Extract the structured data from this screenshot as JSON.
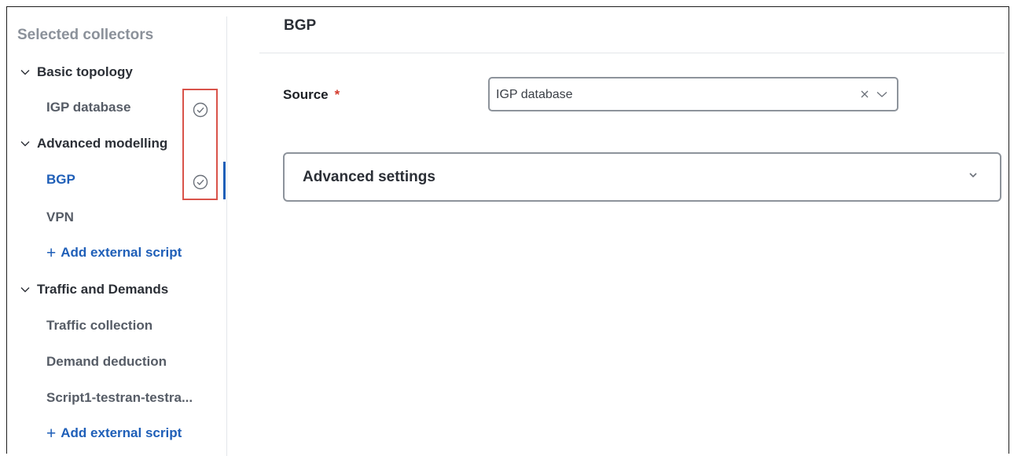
{
  "sidebar": {
    "title": "Selected collectors",
    "groups": [
      {
        "label": "Basic topology",
        "items": [
          {
            "label": "IGP database",
            "status_icon": "check-circle-icon"
          }
        ]
      },
      {
        "label": "Advanced modelling",
        "items": [
          {
            "label": "BGP",
            "status_icon": "check-circle-icon",
            "active": true
          },
          {
            "label": "VPN"
          }
        ],
        "add_link": "Add external script"
      },
      {
        "label": "Traffic and Demands",
        "items": [
          {
            "label": "Traffic collection"
          },
          {
            "label": "Demand deduction"
          },
          {
            "label": "Script1-testran-testra..."
          }
        ],
        "add_link": "Add external script"
      }
    ]
  },
  "main": {
    "title": "BGP",
    "source_field": {
      "label": "Source",
      "required_mark": "*",
      "value": "IGP database"
    },
    "accordion": {
      "label": "Advanced settings"
    }
  },
  "colors": {
    "accent": "#1f5fb8",
    "required": "#d33a2c",
    "highlight": "#d9534a",
    "muted_title": "#8b919a"
  }
}
